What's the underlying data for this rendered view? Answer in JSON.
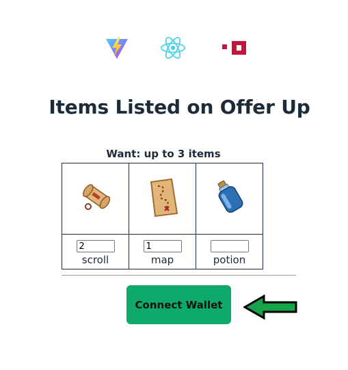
{
  "logos": [
    {
      "name": "vite-logo-icon"
    },
    {
      "name": "react-logo-icon"
    },
    {
      "name": "brand-logo-icon"
    }
  ],
  "page": {
    "title": "Items Listed on Offer Up",
    "want_label": "Want: up to 3 items"
  },
  "items": [
    {
      "icon": "scroll-icon",
      "quantity": "2",
      "label": "scroll"
    },
    {
      "icon": "map-icon",
      "quantity": "1",
      "label": "map"
    },
    {
      "icon": "potion-icon",
      "quantity": "",
      "label": "potion"
    }
  ],
  "actions": {
    "connect_label": "Connect Wallet"
  },
  "colors": {
    "button": "#0daa6b",
    "arrow": "#16a34a",
    "text": "#1c2b3a"
  }
}
